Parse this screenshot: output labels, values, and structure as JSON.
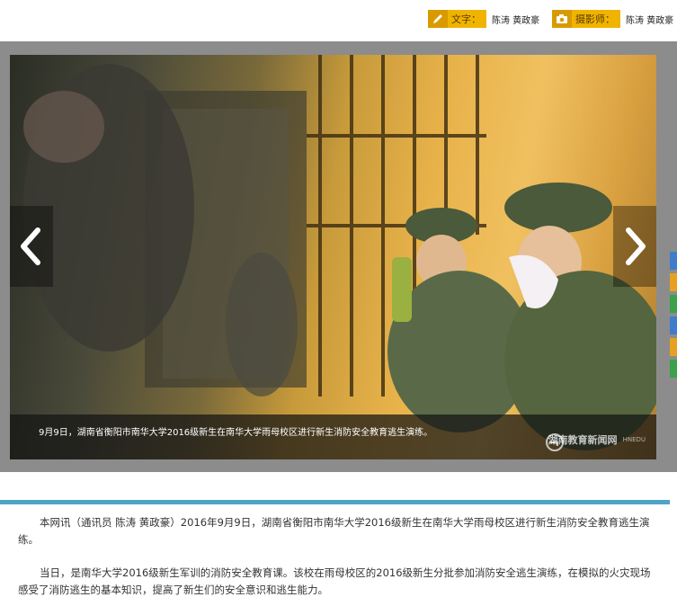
{
  "credits": {
    "writer_label": "文字：",
    "writer_names": "陈涛 黄政豪",
    "photographer_label": "摄影师：",
    "photographer_names": "陈涛 黄政豪"
  },
  "gallery": {
    "caption": "9月9日，湖南省衡阳市南华大学2016级新生在南华大学雨母校区进行新生消防安全教育逃生演练。",
    "watermark": "湖南教育新闻网",
    "watermark_sub": "HNEDU",
    "prev_icon": "chevron-left-icon",
    "next_icon": "chevron-right-icon"
  },
  "article": {
    "paragraphs": [
      "本网讯（通讯员 陈涛 黄政豪）2016年9月9日，湖南省衡阳市南华大学2016级新生在南华大学雨母校区进行新生消防安全教育逃生演练。",
      "当日，是南华大学2016级新生军训的消防安全教育课。该校在雨母校区的2016级新生分批参加消防安全逃生演练，在模拟的火灾现场感受了消防逃生的基本知识，提高了新生们的安全意识和逃生能力。"
    ]
  },
  "colors": {
    "accent": "#4fa3c4",
    "credit_tag": "#f0b400",
    "gallery_bg": "#8c8c8c"
  }
}
